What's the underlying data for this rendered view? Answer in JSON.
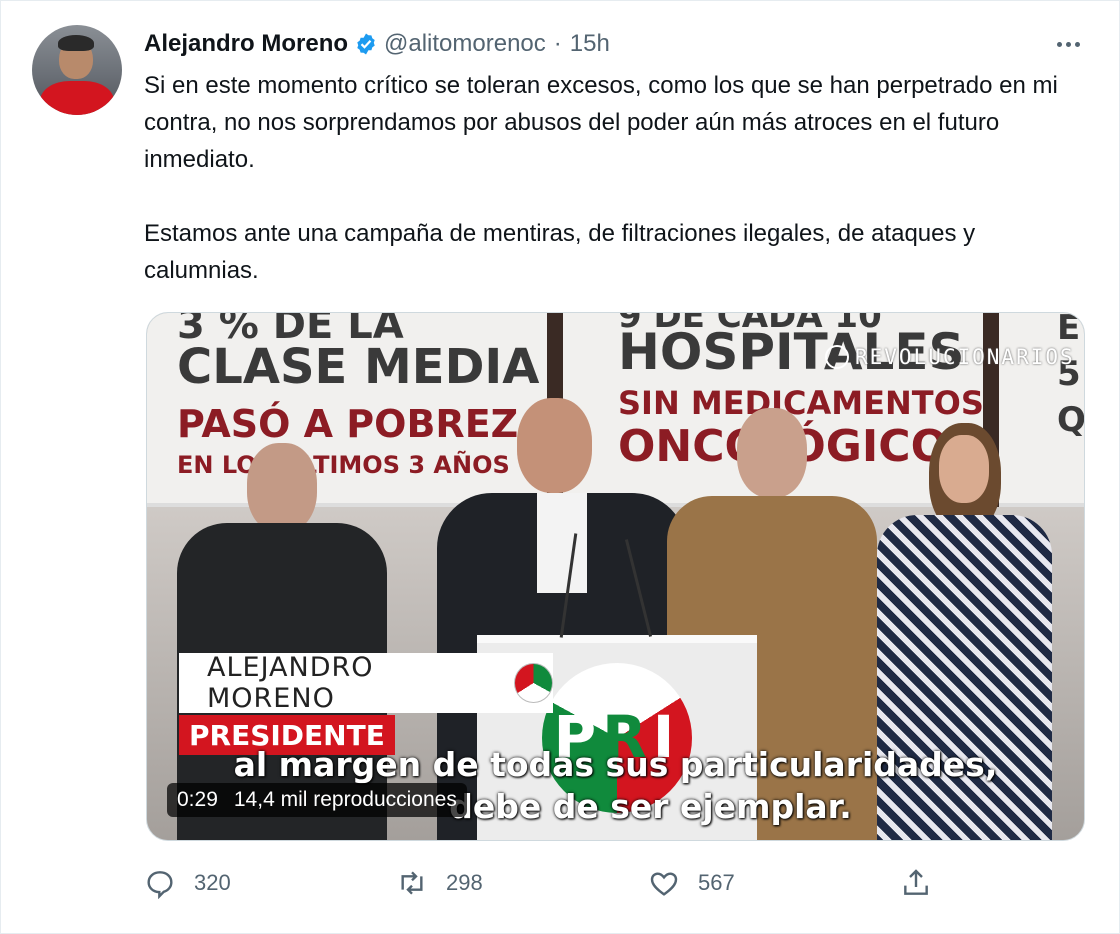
{
  "tweet": {
    "author_name": "Alejandro Moreno",
    "handle": "@alitomorenoc",
    "separator": "·",
    "time": "15h",
    "paragraphs": [
      "Si en este momento crítico se toleran excesos, como los que se han perpetrado en mi contra, no nos sorprendamos por abusos del poder aún más atroces en el futuro inmediato.",
      "Estamos ante una campaña de mentiras, de filtraciones ilegales, de ataques y calumnias."
    ]
  },
  "media": {
    "banner_left": [
      "3 % DE LA",
      "CLASE MEDIA",
      "PASÓ A POBREZA",
      "EN LOS ÚLTIMOS 3 AÑOS"
    ],
    "banner_mid": [
      "9 DE CADA 10",
      "HOSPITALES",
      "SIN MEDICAMENTOS",
      "ONCOLÓGICOS"
    ],
    "banner_right": [
      "E",
      "5",
      "Q"
    ],
    "watermark": "REVOLUCIONARIOS",
    "podium_letters": [
      "P",
      "R",
      "I"
    ],
    "lower_third_name": "ALEJANDRO MORENO",
    "lower_third_badge": "PRI",
    "lower_third_title": "PRESIDENTE",
    "subtitle_line1": "al margen de todas sus particularidades,",
    "subtitle_line2": "debe de ser ejemplar.",
    "duration": "0:29",
    "views": "14,4 mil reproducciones",
    "progress": 0
  },
  "actions": {
    "reply_count": "320",
    "retweet_count": "298",
    "like_count": "567"
  },
  "colors": {
    "verified": "#1d9bf0",
    "secondary_text": "#536471",
    "pri_red": "#d3151f",
    "pri_green": "#108a3c"
  },
  "icons": [
    "verified-badge-icon",
    "more-icon",
    "reply-icon",
    "retweet-icon",
    "like-icon",
    "share-icon",
    "play-icon"
  ]
}
